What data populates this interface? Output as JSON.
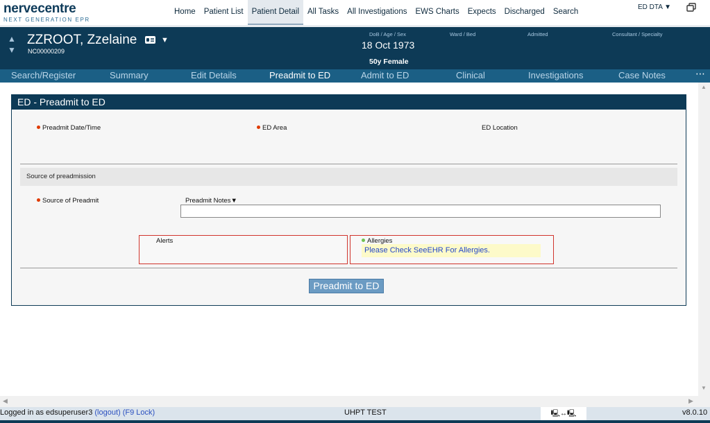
{
  "logo": {
    "main": "nervecentre",
    "sub": "NEXT GENERATION EPR"
  },
  "topnav": [
    "Home",
    "Patient List",
    "Patient Detail",
    "All Tasks",
    "All Investigations",
    "EWS Charts",
    "Expects",
    "Discharged",
    "Search"
  ],
  "topnav_active": "Patient Detail",
  "ward_selector": "ED DTA ▼",
  "patient": {
    "name": "ZZROOT, Zzelaine",
    "caret": "▼",
    "id": "NC00000209",
    "dob_label": "DoB / Age / Sex",
    "dob": "18 Oct 1973",
    "age_sex": "50y Female",
    "ward_label": "Ward / Bed",
    "admitted_label": "Admitted",
    "consultant_label": "Consultant / Specialty"
  },
  "subnav": [
    "Search/Register",
    "Summary",
    "Edit Details",
    "Preadmit to ED",
    "Admit to ED",
    "Clinical",
    "Investigations",
    "Case Notes"
  ],
  "subnav_active": "Preadmit to ED",
  "subnav_more": "⋯",
  "panel": {
    "title": "ED - Preadmit to ED",
    "preadmit_datetime": "Preadmit Date/Time",
    "ed_area": "ED Area",
    "ed_location": "ED Location",
    "section_title": "Source of preadmission",
    "source_label": "Source of Preadmit",
    "notes_label": "Preadmit Notes▼",
    "notes_value": "",
    "alerts_label": "Alerts",
    "allergies_label": "Allergies",
    "allergies_msg": "Please Check SeeEHR For Allergies.",
    "submit_label": "Preadmit to ED"
  },
  "status": {
    "login_text": "Logged in as edsuperuser3",
    "logout": "(logout)",
    "lock": "(F9 Lock)",
    "env": "UHPT TEST",
    "connection": "🖳↔🖳",
    "version": "v8.0.10"
  }
}
